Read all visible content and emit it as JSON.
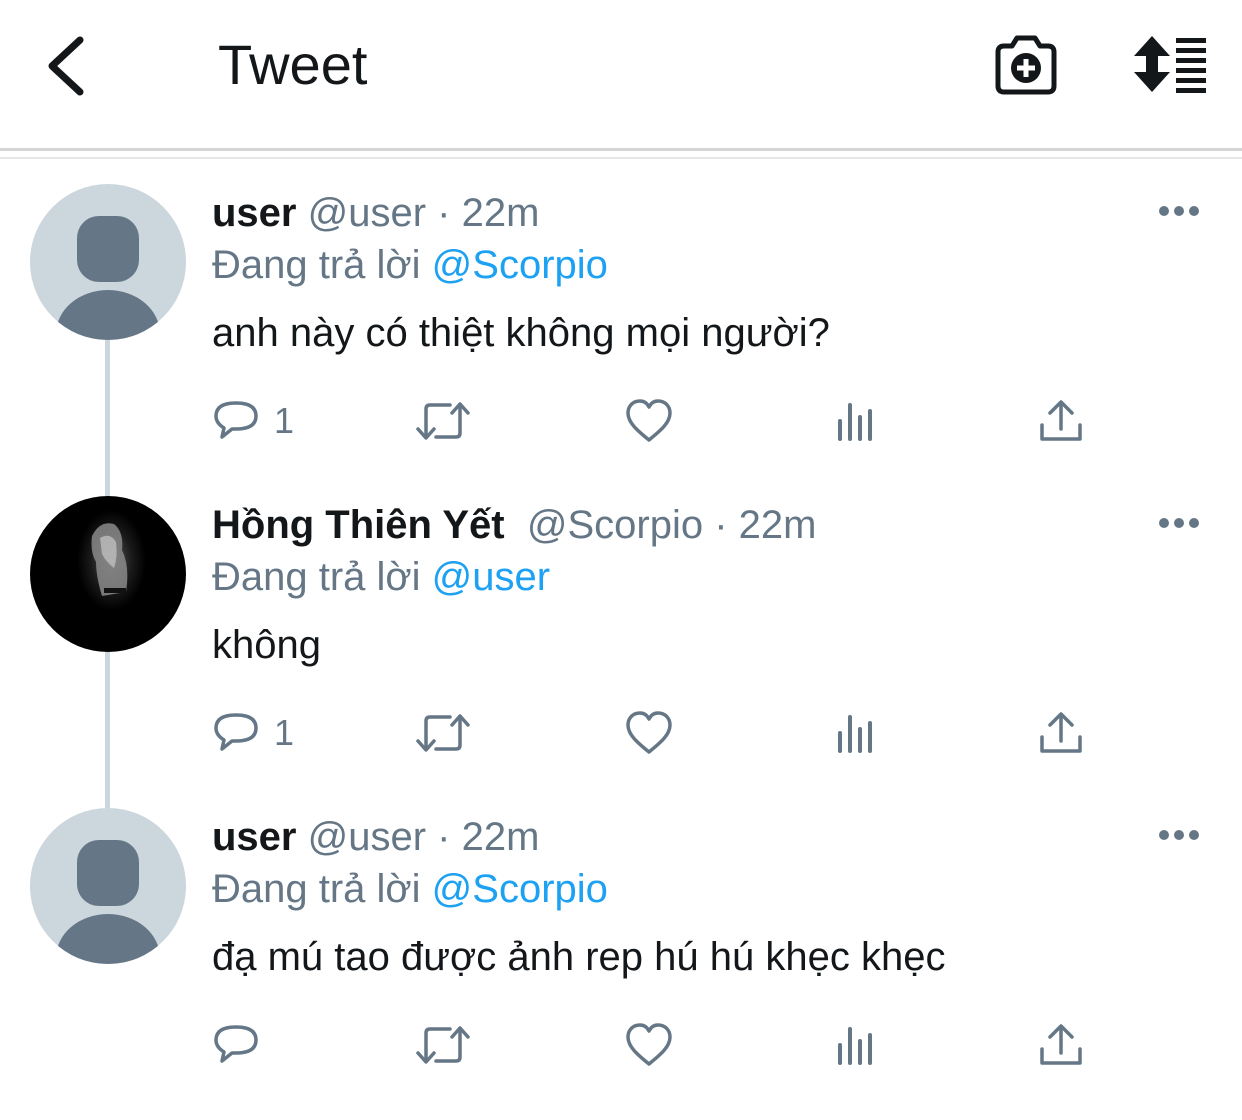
{
  "header": {
    "title": "Tweet",
    "back_icon": "chevron-left-icon",
    "camera_icon": "camera-plus-icon",
    "sort_icon": "sort-list-icon"
  },
  "colors": {
    "link": "#1da1f2",
    "secondary_text": "#657786",
    "primary_text": "#14171a",
    "thread_line": "#ccd6dd",
    "default_avatar_bg": "#ccd6dd",
    "default_avatar_fg": "#657786"
  },
  "tweets": [
    {
      "name": "user",
      "handle": "@user",
      "separator": "·",
      "time": "22m",
      "reply_prefix": "Đang trả lời",
      "reply_to": "@Scorpio",
      "text": "anh này có thiệt không mọi người?",
      "reply_count": "1",
      "avatar": "default-avatar"
    },
    {
      "name": "Hồng Thiên Yết",
      "handle": "@Scorpio",
      "separator": "·",
      "time": "22m",
      "reply_prefix": "Đang trả lời",
      "reply_to": "@user",
      "text": "không",
      "reply_count": "1",
      "avatar": "photo-avatar"
    },
    {
      "name": "user",
      "handle": "@user",
      "separator": "·",
      "time": "22m",
      "reply_prefix": "Đang trả lời",
      "reply_to": "@Scorpio",
      "text": "đạ mú tao được ảnh rep hú hú khẹc khẹc",
      "reply_count": "",
      "avatar": "default-avatar"
    }
  ]
}
